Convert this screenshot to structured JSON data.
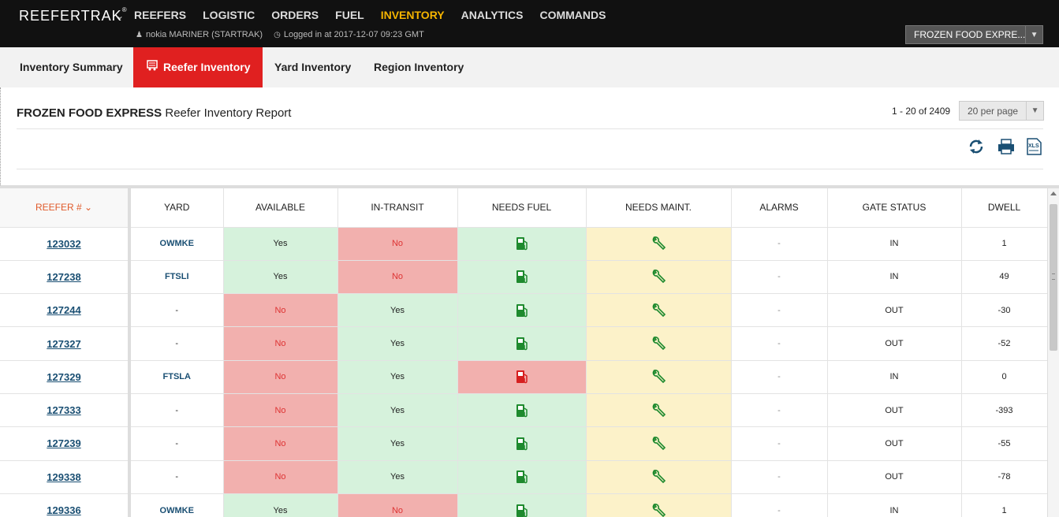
{
  "app": {
    "brand": "REEFERTRAK",
    "brand_sup": "®"
  },
  "nav": {
    "items": [
      "REEFERS",
      "LOGISTIC",
      "ORDERS",
      "FUEL",
      "INVENTORY",
      "ANALYTICS",
      "COMMANDS"
    ],
    "active": "INVENTORY"
  },
  "user": {
    "name": "nokia MARINER (STARTRAK)",
    "login": "Logged in at 2017-12-07 09:23 GMT"
  },
  "company_select": {
    "value": "FROZEN FOOD EXPRE..."
  },
  "tabs": [
    "Inventory Summary",
    "Reefer Inventory",
    "Yard Inventory",
    "Region Inventory"
  ],
  "report": {
    "company": "FROZEN FOOD EXPRESS",
    "title": "Reefer Inventory Report",
    "range": "1 - 20 of 2409",
    "per_page": "20 per page"
  },
  "columns": [
    "REEFER #",
    "YARD",
    "AVAILABLE",
    "IN-TRANSIT",
    "NEEDS FUEL",
    "NEEDS MAINT.",
    "ALARMS",
    "GATE STATUS",
    "DWELL"
  ],
  "rows": [
    {
      "reefer": "123032",
      "yard": "OWMKE",
      "available": "Yes",
      "in_transit": "No",
      "fuel_ok": true,
      "alarms": "-",
      "gate": "IN",
      "dwell": "1"
    },
    {
      "reefer": "127238",
      "yard": "FTSLI",
      "available": "Yes",
      "in_transit": "No",
      "fuel_ok": true,
      "alarms": "-",
      "gate": "IN",
      "dwell": "49"
    },
    {
      "reefer": "127244",
      "yard": "-",
      "available": "No",
      "in_transit": "Yes",
      "fuel_ok": true,
      "alarms": "-",
      "gate": "OUT",
      "dwell": "-30"
    },
    {
      "reefer": "127327",
      "yard": "-",
      "available": "No",
      "in_transit": "Yes",
      "fuel_ok": true,
      "alarms": "-",
      "gate": "OUT",
      "dwell": "-52"
    },
    {
      "reefer": "127329",
      "yard": "FTSLA",
      "available": "No",
      "in_transit": "Yes",
      "fuel_ok": false,
      "alarms": "-",
      "gate": "IN",
      "dwell": "0"
    },
    {
      "reefer": "127333",
      "yard": "-",
      "available": "No",
      "in_transit": "Yes",
      "fuel_ok": true,
      "alarms": "-",
      "gate": "OUT",
      "dwell": "-393"
    },
    {
      "reefer": "127239",
      "yard": "-",
      "available": "No",
      "in_transit": "Yes",
      "fuel_ok": true,
      "alarms": "-",
      "gate": "OUT",
      "dwell": "-55"
    },
    {
      "reefer": "129338",
      "yard": "-",
      "available": "No",
      "in_transit": "Yes",
      "fuel_ok": true,
      "alarms": "-",
      "gate": "OUT",
      "dwell": "-78"
    },
    {
      "reefer": "129336",
      "yard": "OWMKE",
      "available": "Yes",
      "in_transit": "No",
      "fuel_ok": true,
      "alarms": "-",
      "gate": "IN",
      "dwell": "1"
    }
  ],
  "colors": {
    "brand_bar": "#111111",
    "active_nav": "#f5b400",
    "active_tab": "#e02020",
    "ok": "#d6f2dc",
    "bad": "#f2b0ae",
    "warn": "#fcf2c9",
    "fuel_ok": "#1e8a2e",
    "fuel_bad": "#d61f1f",
    "link": "#1a4f73"
  },
  "icons": {
    "fuel": "fuel-pump-icon",
    "maint": "wrench-icon",
    "refresh": "refresh-icon",
    "print": "print-icon",
    "xls": "xls-export-icon"
  }
}
